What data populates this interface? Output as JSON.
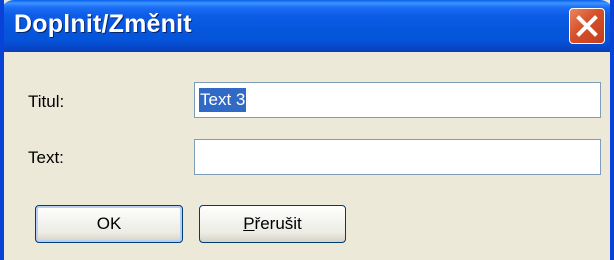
{
  "window": {
    "title": "Doplnit/Změnit"
  },
  "icons": {
    "close": "close-icon"
  },
  "form": {
    "title_label": "Titul:",
    "title_value": "Text 3",
    "text_label": "Text:",
    "text_value": ""
  },
  "buttons": {
    "ok_label": "OK",
    "cancel_mnemonic": "P",
    "cancel_rest": "řerušit"
  },
  "colors": {
    "titlebar": "#0656dd",
    "close_button": "#d6502a",
    "dialog_background": "#ece9d8",
    "selection": "#316ac5",
    "field_border": "#7f9db9"
  }
}
